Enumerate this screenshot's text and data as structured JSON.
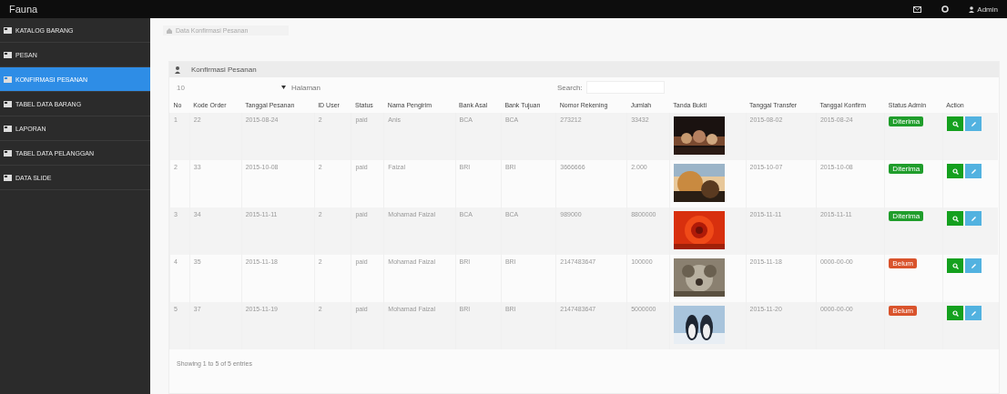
{
  "brand": "Fauna",
  "topbar": {
    "user": "Admin"
  },
  "sidebar": {
    "items": [
      {
        "label": "KATALOG BARANG",
        "selected": false
      },
      {
        "label": "PESAN",
        "selected": false
      },
      {
        "label": "KONFIRMASI PESANAN",
        "selected": true
      },
      {
        "label": "TABEL DATA BARANG",
        "selected": false
      },
      {
        "label": "LAPORAN",
        "selected": false
      },
      {
        "label": "TABEL DATA PELANGGAN",
        "selected": false
      },
      {
        "label": "DATA SLIDE",
        "selected": false
      }
    ]
  },
  "breadcrumb": "Data Konfirmasi Pesanan",
  "panel": {
    "title": "Konfirmasi Pesanan",
    "page_size": "10",
    "page_size_label": "Halaman",
    "search_label": "Search:"
  },
  "table": {
    "columns": [
      "No",
      "Kode Order",
      "Tanggal Pesanan",
      "ID User",
      "Status",
      "Nama Pengirim",
      "Bank Asal",
      "Bank Tujuan",
      "Nomor Rekening",
      "Jumlah",
      "Tanda Bukti",
      "Tanggal Transfer",
      "Tanggal Konfirm",
      "Status Admin",
      "Action"
    ],
    "rows": [
      {
        "cells": [
          "1",
          "22",
          "2015-08-24",
          "2",
          "paid",
          "Anis",
          "BCA",
          "BCA",
          "273212",
          "33432"
        ],
        "transfer": "2015-08-02",
        "confirm": "2015-08-24",
        "admin_status": {
          "label": "Diterima",
          "color": "#1f9d2b"
        }
      },
      {
        "cells": [
          "2",
          "33",
          "2015-10-08",
          "2",
          "paid",
          "Faizal",
          "BRI",
          "BRI",
          "3666666",
          "2.000"
        ],
        "transfer": "2015-10-07",
        "confirm": "2015-10-08",
        "admin_status": {
          "label": "Diterima",
          "color": "#1f9d2b"
        }
      },
      {
        "cells": [
          "3",
          "34",
          "2015-11-11",
          "2",
          "paid",
          "Mohamad Faizal",
          "BCA",
          "BCA",
          "989000",
          "8800000"
        ],
        "transfer": "2015-11-11",
        "confirm": "2015-11-11",
        "admin_status": {
          "label": "Diterima",
          "color": "#1f9d2b"
        }
      },
      {
        "cells": [
          "4",
          "35",
          "2015-11-18",
          "2",
          "paid",
          "Mohamad Faizal",
          "BRI",
          "BRI",
          "2147483647",
          "100000"
        ],
        "transfer": "2015-11-18",
        "confirm": "0000-00-00",
        "admin_status": {
          "label": "Belum",
          "color": "#d9532c"
        }
      },
      {
        "cells": [
          "5",
          "37",
          "2015-11-19",
          "2",
          "paid",
          "Mohamad Faizal",
          "BRI",
          "BRI",
          "2147483647",
          "5000000"
        ],
        "transfer": "2015-11-20",
        "confirm": "0000-00-00",
        "admin_status": {
          "label": "Belum",
          "color": "#d9532c"
        }
      }
    ]
  },
  "footer": "Showing 1 to 5 of 5 entries"
}
